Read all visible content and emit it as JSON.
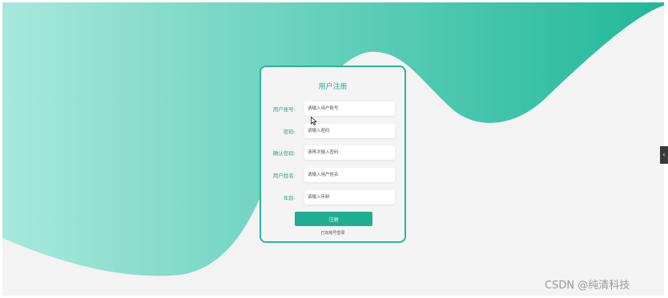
{
  "form": {
    "title": "用户注册",
    "fields": [
      {
        "label": "用户账号:",
        "placeholder": "请输入用户账号"
      },
      {
        "label": "密码:",
        "placeholder": "请输入密码"
      },
      {
        "label": "确认密码:",
        "placeholder": "请再次输入密码"
      },
      {
        "label": "用户姓名:",
        "placeholder": "请输入用户姓名"
      },
      {
        "label": "年龄:",
        "placeholder": "请输入年龄"
      }
    ],
    "submit_label": "注册",
    "login_link": "已有账号登录"
  },
  "side_toggle": {
    "icon": "chevron-left-icon",
    "glyph": "‹"
  },
  "watermark": "CSDN @纯清科技",
  "colors": {
    "accent": "#1fae8f",
    "wave_light": "#a8e8dc",
    "wave_dark": "#22b89a",
    "background": "#f3f3f3"
  }
}
